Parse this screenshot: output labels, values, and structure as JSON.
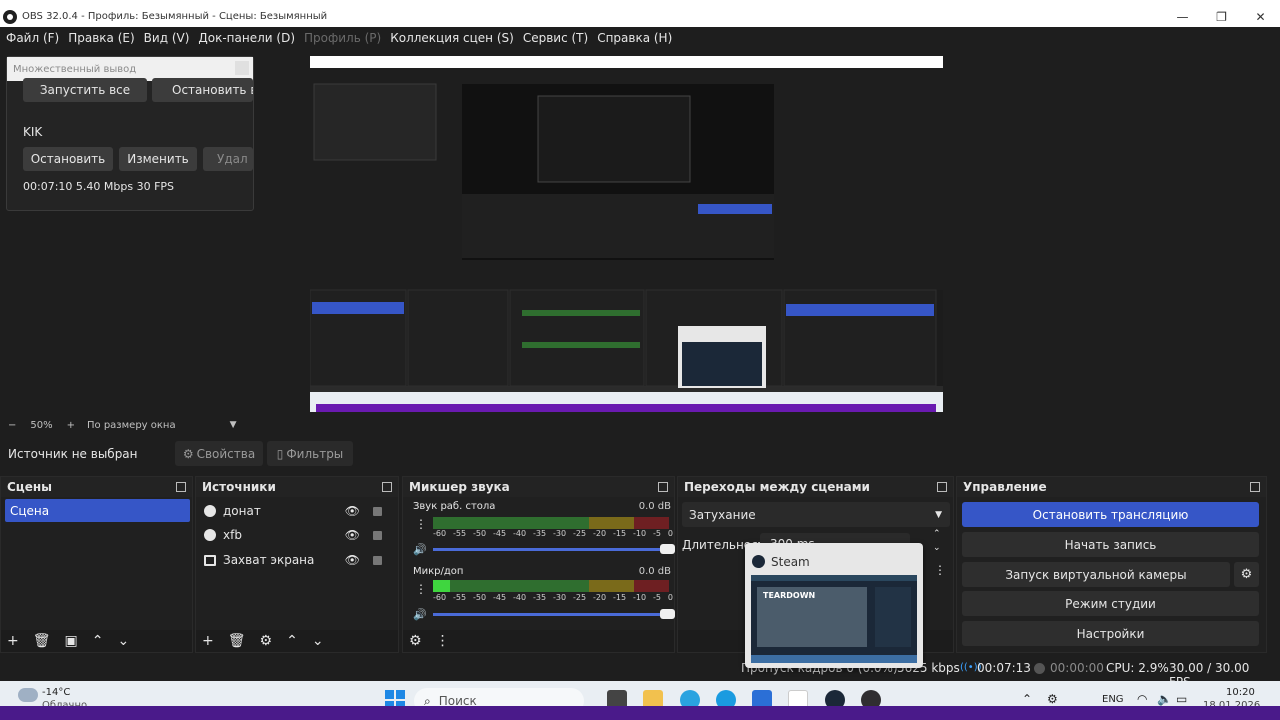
{
  "window": {
    "title": "OBS 32.0.4 - Профиль: Безымянный - Сцены: Безымянный",
    "controls": {
      "minimize": "—",
      "maximize": "❐",
      "close": "✕"
    }
  },
  "menu": {
    "items": [
      "Файл (F)",
      "Правка (E)",
      "Вид (V)",
      "Док-панели (D)",
      "Профиль (P)",
      "Коллекция сцен (S)",
      "Сервис (T)",
      "Справка (H)"
    ]
  },
  "multi_output": {
    "title": "Множественный вывод",
    "start_all": "Запустить все",
    "stop_all": "Остановить в",
    "target_name": "KIK",
    "stop": "Остановить",
    "edit": "Изменить",
    "delete": "Удал",
    "stats": "00:07:10  5.40 Mbps  30 FPS"
  },
  "zoom": {
    "minus": "−",
    "value": "50%",
    "plus": "+",
    "fit": "По размеру окна"
  },
  "source_bar": {
    "label": "Источник не выбран",
    "properties": "Свойства",
    "filters": "Фильтры"
  },
  "scenes": {
    "title": "Сцены",
    "items": [
      "Сцена"
    ]
  },
  "sources": {
    "title": "Источники",
    "items": [
      "донат",
      "xfb",
      "Захват экрана"
    ]
  },
  "mixer": {
    "title": "Микшер звука",
    "tracks": [
      {
        "name": "Звук раб. стола",
        "db": "0.0 dB",
        "level": 0
      },
      {
        "name": "Микр/доп",
        "db": "0.0 dB",
        "level": 0.07
      }
    ],
    "scale": [
      "-60",
      "-55",
      "-50",
      "-45",
      "-40",
      "-35",
      "-30",
      "-25",
      "-20",
      "-15",
      "-10",
      "-5",
      "0"
    ]
  },
  "transitions": {
    "title": "Переходы между сценами",
    "selected": "Затухание",
    "duration_label": "Длительность",
    "duration_value": "300 ms"
  },
  "controls": {
    "title": "Управление",
    "stop_stream": "Остановить трансляцию",
    "start_record": "Начать запись",
    "virtual_cam": "Запуск виртуальной камеры",
    "studio_mode": "Режим студии",
    "settings": "Настройки"
  },
  "status": {
    "dropped": "Пропуск кадров 0 (0.0%)",
    "bitrate": "5625 kbps",
    "stream_time": "00:07:13",
    "record_time": "00:00:00",
    "cpu": "CPU: 2.9%",
    "fps": "30.00 / 30.00 FPS"
  },
  "steam_popup": {
    "title": "Steam",
    "game": "TEARDOWN"
  },
  "taskbar": {
    "weather_temp": "-14°C",
    "weather_desc": "Облачно",
    "search": "Поиск",
    "lang": "ENG",
    "time": "10:20",
    "date": "18.01.2026"
  },
  "colors": {
    "accent": "#3656c7",
    "meter_green": "#2f6e2f",
    "meter_yellow": "#7a6a1a",
    "meter_red": "#6e1f22",
    "taskbar": "#e9eef3",
    "strip": "#4a1a8a"
  }
}
